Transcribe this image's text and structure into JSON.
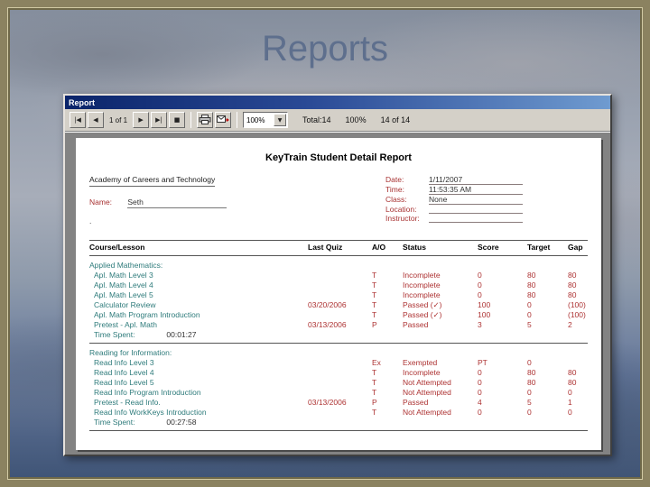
{
  "slide": {
    "title": "Reports"
  },
  "window": {
    "title": "Report",
    "toolbar": {
      "first_page": "|◀",
      "prev_page": "◀",
      "page_label": "1 of 1",
      "next_page": "▶",
      "last_page": "▶|",
      "stop": "■",
      "zoom_value": "100%",
      "dropdown_arrow": "▼",
      "total_label": "Total:14",
      "zoom_percent": "100%",
      "page_count": "14 of 14"
    }
  },
  "report": {
    "title": "KeyTrain Student Detail Report",
    "organization": "Academy of Careers and Technology",
    "name_label": "Name:",
    "name_value": "Seth",
    "name_line2": ".",
    "meta": [
      {
        "label": "Date:",
        "value": "1/11/2007"
      },
      {
        "label": "Time:",
        "value": "11:53:35 AM"
      },
      {
        "label": "Class:",
        "value": "None"
      },
      {
        "label": "Location:",
        "value": ""
      },
      {
        "label": "Instructor:",
        "value": ""
      }
    ],
    "columns": [
      "Course/Lesson",
      "Last Quiz",
      "A/O",
      "Status",
      "Score",
      "Target",
      "Gap"
    ],
    "sections": [
      {
        "heading": "Applied Mathematics:",
        "rows": [
          [
            "Apl. Math Level 3",
            "",
            "T",
            "Incomplete",
            "0",
            "80",
            "80"
          ],
          [
            "Apl. Math Level 4",
            "",
            "T",
            "Incomplete",
            "0",
            "80",
            "80"
          ],
          [
            "Apl. Math Level 5",
            "",
            "T",
            "Incomplete",
            "0",
            "80",
            "80"
          ],
          [
            "Calculator Review",
            "03/20/2006",
            "T",
            "Passed (✓)",
            "100",
            "0",
            "(100)"
          ],
          [
            "Apl. Math Program Introduction",
            "",
            "T",
            "Passed (✓)",
            "100",
            "0",
            "(100)"
          ],
          [
            "Pretest - Apl. Math",
            "03/13/2006",
            "P",
            "Passed",
            "3",
            "5",
            "2"
          ]
        ],
        "time_label": "Time Spent:",
        "time_value": "00:01:27"
      },
      {
        "heading": "Reading for Information:",
        "rows": [
          [
            "Read Info Level 3",
            "",
            "Ex",
            "Exempted",
            "PT",
            "0",
            ""
          ],
          [
            "Read Info Level 4",
            "",
            "T",
            "Incomplete",
            "0",
            "80",
            "80"
          ],
          [
            "Read Info Level 5",
            "",
            "T",
            "Not Attempted",
            "0",
            "80",
            "80"
          ],
          [
            "Read Info Program Introduction",
            "",
            "T",
            "Not Attempted",
            "0",
            "0",
            "0"
          ],
          [
            "Pretest - Read Info.",
            "03/13/2006",
            "P",
            "Passed",
            "4",
            "5",
            "1"
          ],
          [
            "Read Info WorkKeys Introduction",
            "",
            "T",
            "Not Attempted",
            "0",
            "0",
            "0"
          ]
        ],
        "time_label": "Time Spent:",
        "time_value": "00:27:58"
      }
    ]
  }
}
